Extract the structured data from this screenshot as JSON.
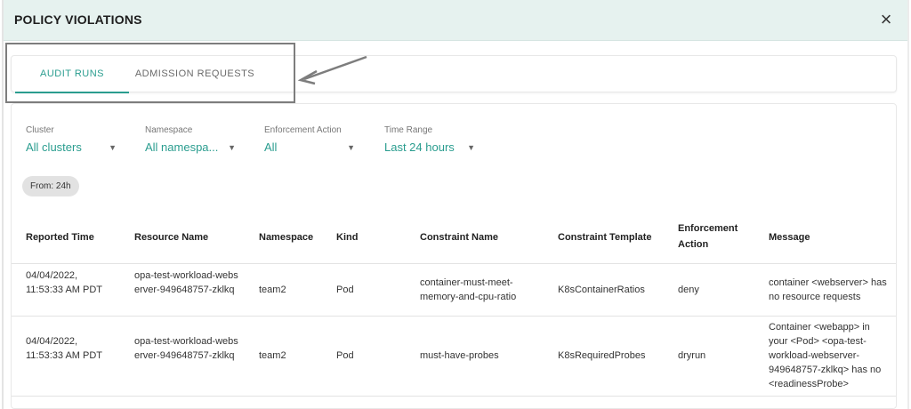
{
  "header": {
    "title": "POLICY VIOLATIONS",
    "close_icon": "×"
  },
  "tabs": [
    {
      "label": "AUDIT RUNS",
      "active": true
    },
    {
      "label": "ADMISSION REQUESTS",
      "active": false
    }
  ],
  "filters": [
    {
      "label": "Cluster",
      "value": "All clusters"
    },
    {
      "label": "Namespace",
      "value": "All namespa..."
    },
    {
      "label": "Enforcement Action",
      "value": "All"
    },
    {
      "label": "Time Range",
      "value": "Last 24 hours"
    }
  ],
  "chip": "From: 24h",
  "table": {
    "headers": [
      "Reported Time",
      "Resource Name",
      "Namespace",
      "Kind",
      "Constraint Name",
      "Constraint Template",
      "Enforcement Action",
      "Message"
    ],
    "rows": [
      {
        "reported_time": "04/04/2022, 11:53:33 AM PDT",
        "resource_name": "opa-test-workload-webserver-949648757-zklkq",
        "namespace": "team2",
        "kind": "Pod",
        "constraint_name": "container-must-meet-memory-and-cpu-ratio",
        "constraint_template": "K8sContainerRatios",
        "enforcement_action": "deny",
        "message": "container <webserver> has no resource requests"
      },
      {
        "reported_time": "04/04/2022, 11:53:33 AM PDT",
        "resource_name": "opa-test-workload-webserver-949648757-zklkq",
        "namespace": "team2",
        "kind": "Pod",
        "constraint_name": "must-have-probes",
        "constraint_template": "K8sRequiredProbes",
        "enforcement_action": "dryrun",
        "message": "Container <webapp> in your <Pod> <opa-test-workload-webserver-949648757-zklkq> has no <readinessProbe>"
      }
    ]
  },
  "colors": {
    "accent": "#2a9d8f",
    "header_bg": "#e6f2ef",
    "annotation": "#7d7d7d"
  }
}
